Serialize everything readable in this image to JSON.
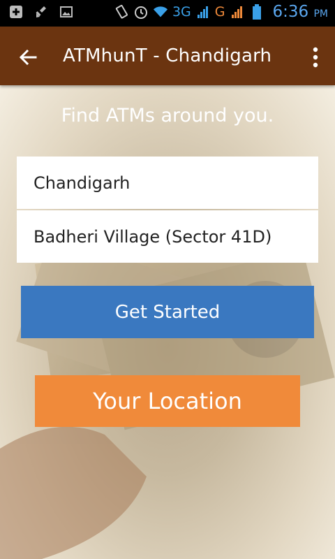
{
  "status_bar": {
    "network_3g": "3G",
    "network_g": "G",
    "time": "6:36",
    "ampm": "PM"
  },
  "action_bar": {
    "title": "ATMhunT - Chandigarh"
  },
  "main": {
    "tagline": "Find ATMs around you.",
    "city_value": "Chandigarh",
    "area_value": "Badheri Village (Sector 41D)",
    "get_started_label": "Get Started",
    "your_location_label": "Your Location"
  },
  "colors": {
    "action_bar": "#6b3410",
    "primary_button": "#3a78c0",
    "secondary_button": "#f08a3a"
  }
}
